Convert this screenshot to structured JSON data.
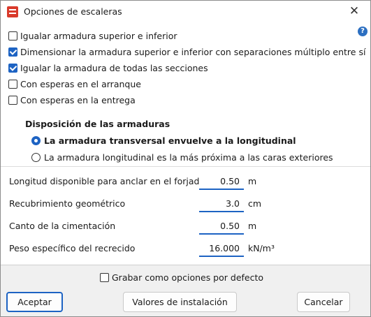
{
  "window": {
    "title": "Opciones de escaleras",
    "close_glyph": "✕"
  },
  "help": {
    "glyph": "?"
  },
  "options": [
    {
      "label": "Igualar armadura superior e inferior",
      "checked": false
    },
    {
      "label": "Dimensionar la armadura superior e inferior con separaciones múltiplo entre sí",
      "checked": true
    },
    {
      "label": "Igualar la armadura de todas las secciones",
      "checked": true
    },
    {
      "label": "Con esperas en el arranque",
      "checked": false
    },
    {
      "label": "Con esperas en la entrega",
      "checked": false
    }
  ],
  "layout_section": {
    "title": "Disposición de las armaduras",
    "radios": [
      {
        "label": "La armadura transversal envuelve a la longitudinal",
        "selected": true
      },
      {
        "label": "La armadura longitudinal es la más próxima a las caras exteriores",
        "selected": false
      }
    ]
  },
  "fields": [
    {
      "label": "Longitud disponible para anclar en el forjado",
      "value": "0.50",
      "unit": "m"
    },
    {
      "label": "Recubrimiento geométrico",
      "value": "3.0",
      "unit": "cm"
    },
    {
      "label": "Canto de la cimentación",
      "value": "0.50",
      "unit": "m"
    },
    {
      "label": "Peso específico del recrecido",
      "value": "16.000",
      "unit": "kN/m³"
    }
  ],
  "default_option": {
    "label": "Grabar como opciones por defecto",
    "checked": false
  },
  "buttons": {
    "accept": "Aceptar",
    "install_values": "Valores de instalación",
    "cancel": "Cancelar"
  },
  "colors": {
    "accent": "#1d63c3",
    "app_icon": "#d93a2b"
  }
}
